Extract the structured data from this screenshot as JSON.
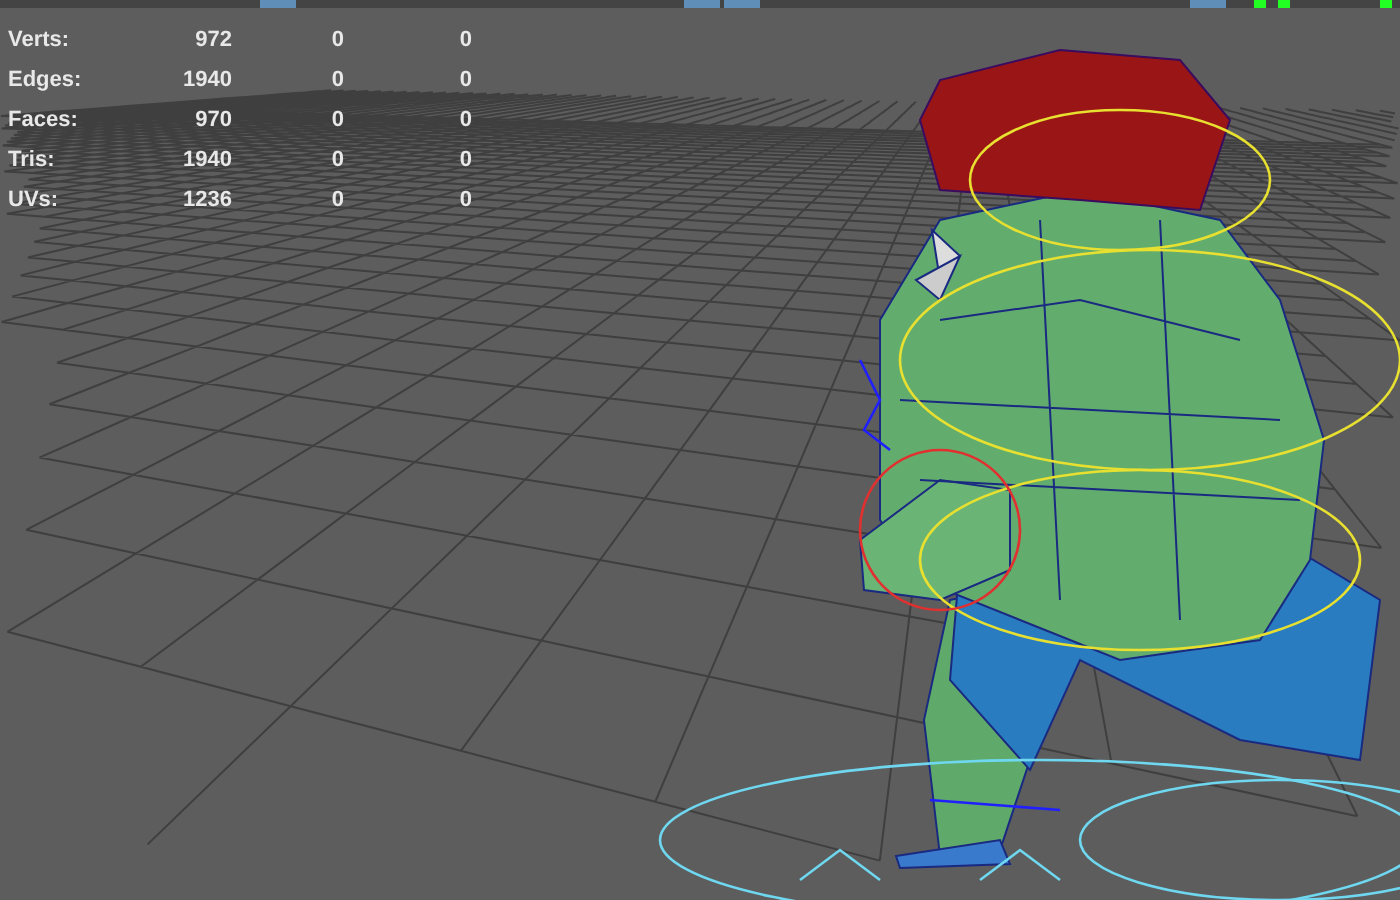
{
  "heads_up_display": {
    "rows": [
      {
        "label": "Verts:",
        "value": "972",
        "column_3": "0",
        "column_4": "0"
      },
      {
        "label": "Edges:",
        "value": "1940",
        "column_3": "0",
        "column_4": "0"
      },
      {
        "label": "Faces:",
        "value": "970",
        "column_3": "0",
        "column_4": "0"
      },
      {
        "label": "Tris:",
        "value": "1940",
        "column_3": "0",
        "column_4": "0"
      },
      {
        "label": "UVs:",
        "value": "1236",
        "column_3": "0",
        "column_4": "0"
      }
    ]
  }
}
